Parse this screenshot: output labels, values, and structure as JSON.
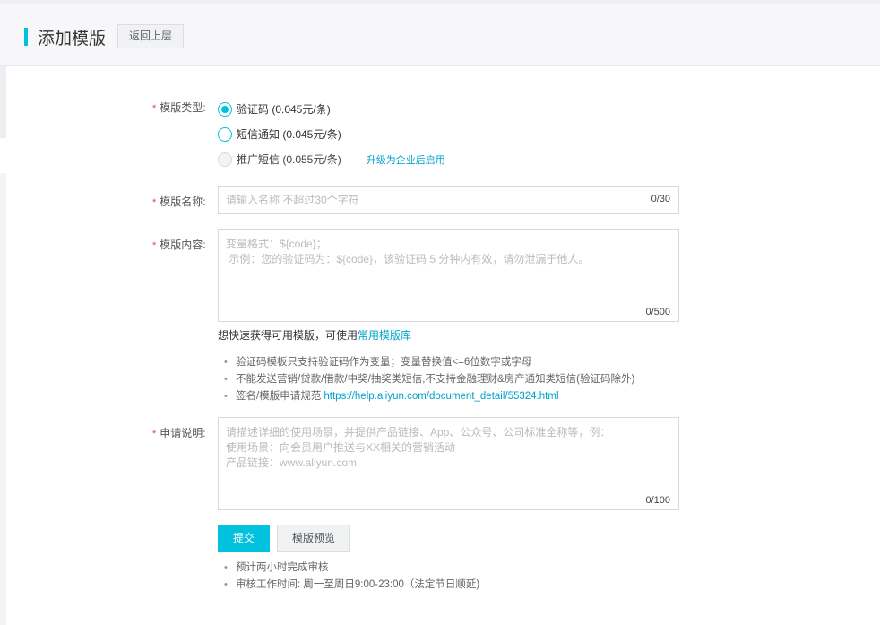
{
  "header": {
    "title": "添加模版",
    "back_label": "返回上层"
  },
  "form": {
    "required_mark": "*",
    "type_label": "模版类型:",
    "type_options": [
      {
        "label": "验证码 (0.045元/条)",
        "checked": true,
        "disabled": false
      },
      {
        "label": "短信通知 (0.045元/条)",
        "checked": false,
        "disabled": false
      },
      {
        "label": "推广短信 (0.055元/条)",
        "checked": false,
        "disabled": true
      }
    ],
    "upgrade_link": "升级为企业后启用",
    "name_label": "模版名称:",
    "name_placeholder": "请输入名称 不超过30个字符",
    "name_counter": "0/30",
    "content_label": "模版内容:",
    "content_placeholder": "变量格式：${code}；\n 示例：您的验证码为：${code}，该验证码 5 分钟内有效，请勿泄漏于他人。",
    "content_counter": "0/500",
    "quick_text": "想快速获得可用模版，可使用",
    "quick_link": "常用模版库",
    "tips": [
      "验证码模板只支持验证码作为变量；变量替换值<=6位数字或字母",
      "不能发送营销/贷款/借款/中奖/抽奖类短信,不支持金融理财&房产通知类短信(验证码除外)"
    ],
    "tip_spec_text": "签名/模版申请规范 ",
    "tip_spec_link": "https://help.aliyun.com/document_detail/55324.html",
    "apply_label": "申请说明:",
    "apply_placeholder": "请描述详细的使用场景，并提供产品链接、App、公众号、公司标准全称等，例：\n使用场景：向会员用户推送与XX相关的营销活动\n产品链接：www.aliyun.com",
    "apply_counter": "0/100",
    "submit_label": "提交",
    "preview_label": "模版预览",
    "footer_tips": [
      "预计两小时完成审核",
      "审核工作时间: 周一至周日9:00-23:00（法定节日顺延)"
    ]
  },
  "colors": {
    "accent": "#00c1de",
    "link": "#00a2ca",
    "required": "#e8463b"
  }
}
